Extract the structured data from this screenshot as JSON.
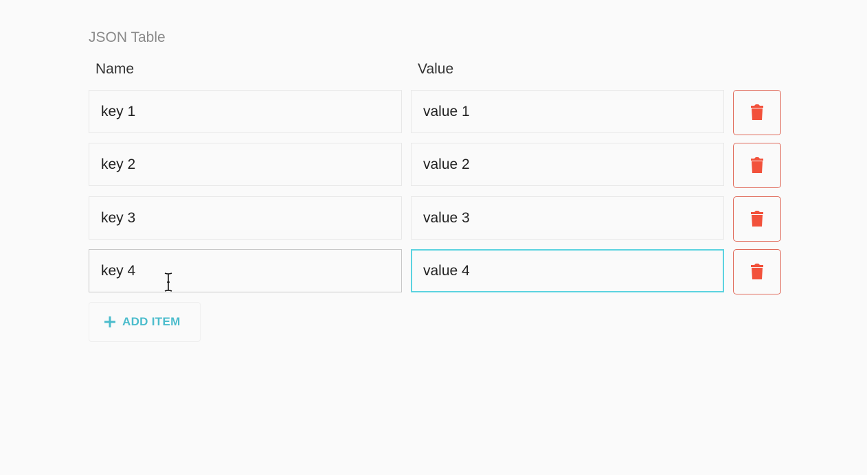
{
  "title": "JSON Table",
  "columns": {
    "name": "Name",
    "value": "Value"
  },
  "rows": [
    {
      "name": "key 1",
      "value": "value 1"
    },
    {
      "name": "key 2",
      "value": "value 2"
    },
    {
      "name": "key 3",
      "value": "value 3"
    },
    {
      "name": "key 4",
      "value": "value 4"
    }
  ],
  "add_button": {
    "label": "ADD ITEM",
    "icon": "plus-icon"
  },
  "delete_icon": "trash-icon",
  "colors": {
    "accent": "#4bbccc",
    "focus": "#5cd3e0",
    "danger": "#f2513b",
    "danger_border": "#e06a5a"
  }
}
